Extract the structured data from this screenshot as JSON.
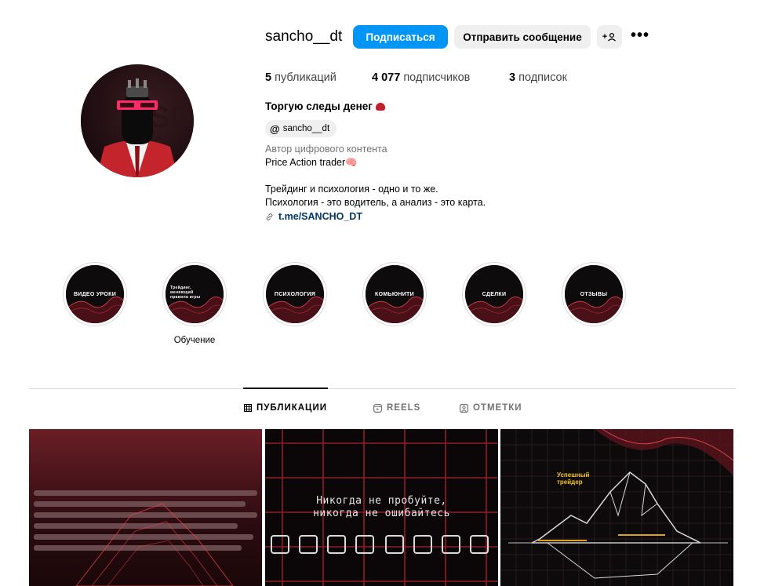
{
  "profile": {
    "username": "sancho__dt",
    "follow_label": "Подписаться",
    "message_label": "Отправить сообщение",
    "add_person_glyph": "+",
    "more_glyph": "•••",
    "stats": {
      "posts_count": "5",
      "posts_label": "публикаций",
      "followers_count": "4 077",
      "followers_label": "подписчиков",
      "following_count": "3",
      "following_label": "подписок"
    },
    "display_name": "Торгую следы денег",
    "threads_handle": "sancho__dt",
    "category": "Автор цифрового контента",
    "bio": "Price Action trader🧠\n\nТрейдинг и психология - одно и то же.\nПсихология - это водитель, а анализ - это карта.",
    "link": "t.me/SANCHO_DT",
    "accent_color": "#0095f6"
  },
  "highlights": [
    {
      "title": "ВИДЕО УРОКИ",
      "caption": ""
    },
    {
      "title": "Трейдинг, меняющий правила игры",
      "caption": "Обучение"
    },
    {
      "title": "ПСИХОЛОГИЯ",
      "caption": ""
    },
    {
      "title": "КОМЬЮНИТИ",
      "caption": ""
    },
    {
      "title": "СДЕЛКИ",
      "caption": ""
    },
    {
      "title": "ОТЗЫВЫ",
      "caption": ""
    }
  ],
  "tabs": [
    {
      "label": "ПУБЛИКАЦИИ",
      "icon": "grid-icon",
      "active": true
    },
    {
      "label": "REELS",
      "icon": "reels-icon",
      "active": false
    },
    {
      "label": "ОТМЕТКИ",
      "icon": "tagged-icon",
      "active": false
    }
  ],
  "posts": [
    {
      "text": ""
    },
    {
      "text_line1": "Никогда не пробуйте,",
      "text_line2": "никогда не ошибайтесь"
    },
    {
      "text_line1": "Успешный",
      "text_line2": "трейдер"
    }
  ]
}
